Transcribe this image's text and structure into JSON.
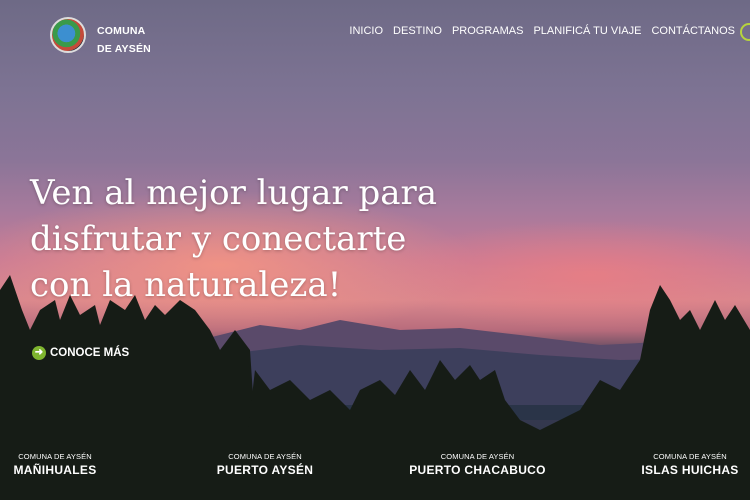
{
  "brand": {
    "line1": "COMUNA",
    "line2": "DE AYSÉN"
  },
  "nav": [
    "INICIO",
    "DESTINO",
    "PROGRAMAS",
    "PLANIFICÁ TU VIAJE",
    "CONTÁCTANOS"
  ],
  "hero": {
    "headline_lines": [
      "Ven al mejor lugar para",
      "disfrutar y conectarte",
      "con la naturaleza!"
    ],
    "cta_label": "CONOCE MÁS"
  },
  "locations": [
    {
      "subtitle": "COMUNA DE AYSÉN",
      "name": "MAÑIHUALES"
    },
    {
      "subtitle": "COMUNA DE AYSÉN",
      "name": "PUERTO AYSÉN"
    },
    {
      "subtitle": "COMUNA DE AYSÉN",
      "name": "PUERTO CHACABUCO"
    },
    {
      "subtitle": "COMUNA DE AYSÉN",
      "name": "ISLAS HUICHAS"
    }
  ]
}
